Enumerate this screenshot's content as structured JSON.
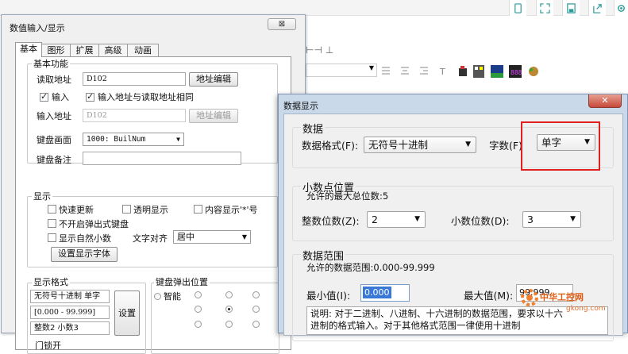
{
  "window1": {
    "title": "数值输入/显示",
    "close_glyph": "⊠",
    "tabs": [
      "基本",
      "图形",
      "扩展",
      "高级",
      "动画"
    ],
    "basic_group": {
      "label": "基本功能",
      "read_address_label": "读取地址",
      "read_address_value": "D102",
      "address_edit_button": "地址编辑",
      "input_checkbox_label": "输入",
      "same_address_checkbox_label": "输入地址与读取地址相同",
      "input_address_label": "输入地址",
      "input_address_value": "D102",
      "input_address_edit_button": "地址编辑",
      "keyboard_screen_label": "键盘画面",
      "keyboard_screen_value": "1000: BuilNum",
      "keyboard_note_label": "键盘备注",
      "keyboard_note_value": ""
    },
    "display_group": {
      "label": "显示",
      "quick_update": "快速更新",
      "transparent": "透明显示",
      "content_display": "内容显示'*'号",
      "no_popup_keyboard": "不开启弹出式键盘",
      "show_natural_decimal": "显示自然小数",
      "text_align_label": "文字对齐",
      "text_align_value": "居中",
      "font_button": "设置显示字体"
    },
    "format_group": {
      "label": "显示格式",
      "line1": "无符号十进制 单字",
      "line2": "[0.000 - 99.999]",
      "line3": "整数2 小数3",
      "settings_button": "设置"
    },
    "popup_group": {
      "label": "键盘弹出位置",
      "smart_label": "智能"
    },
    "bottom_label": "门锁开"
  },
  "window2": {
    "title": "数据显示",
    "close_glyph": "✕",
    "data_section": {
      "label": "数据",
      "format_label": "数据格式(F):",
      "format_value": "无符号十进制",
      "words_label": "字数(F)",
      "words_value": "单字"
    },
    "decimal_section": {
      "label": "小数点位置",
      "max_digits_text": "允许的最大总位数:5",
      "int_digits_label": "整数位数(Z):",
      "int_digits_value": "2",
      "dec_digits_label": "小数位数(D):",
      "dec_digits_value": "3"
    },
    "range_section": {
      "label": "数据范围",
      "allowed_range_text": "允许的数据范围:0.000-99.999",
      "min_label": "最小值(I):",
      "min_value": "0.000",
      "max_label": "最大值(M):",
      "max_value": "99.999",
      "note_line1": "说明: 对于二进制、八进制、十六进制的数据范围，要求以十六",
      "note_line2": "进制的格式输入。对于其他格式范围一律使用十进制"
    }
  },
  "watermark": {
    "text": "中华工控网",
    "url": "gkong.com"
  },
  "colors": {
    "highlight_red": "#e02020",
    "selection_blue": "#3a78d8",
    "dialog_frame": "#c9d9ea"
  }
}
